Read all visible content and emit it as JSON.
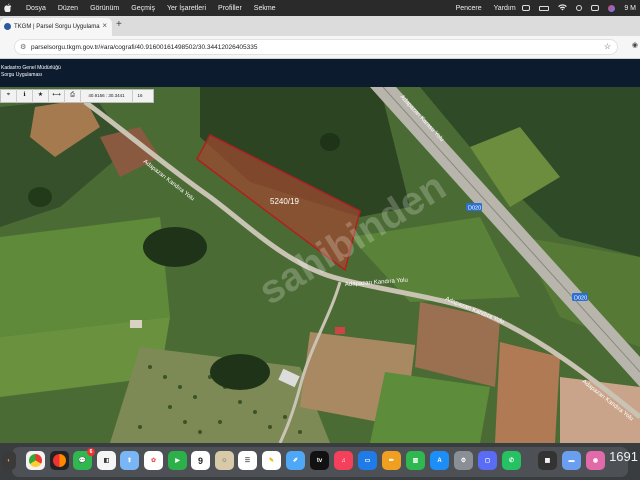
{
  "menubar": {
    "items": [
      "Dosya",
      "Düzen",
      "Görünüm",
      "Geçmiş",
      "Yer İşaretleri",
      "Profiller",
      "Sekme",
      "Pencere",
      "Yardım"
    ],
    "right_time": "9 M"
  },
  "browser": {
    "tab_title": "TKGM | Parsel Sorgu Uygulama",
    "url": "parselsorgu.tkgm.gov.tr/#ara/cografi/40.91600161498502/30.34412026405335"
  },
  "site": {
    "org_line": "Kadastro Genel Müdürlüğü",
    "app_line": "Sorgu Uygulaması"
  },
  "map_toolbar": {
    "coords": "40.9156 : 30.3441",
    "scale": "16"
  },
  "map": {
    "parcel_label": "5240/19",
    "road_labels": [
      "Adapazarı Kandıra Yolu",
      "Adapazarı Kandıra Yolu",
      "Adapazarı Kandıra Yolu",
      "Adapazarı Kandıra Yolu",
      "Adapazarı Karasu Yolu"
    ],
    "highway_badges": [
      "D020",
      "D020"
    ],
    "watermark": "sahibinden",
    "parcel_color": "#b02020"
  },
  "dock": {
    "badges": [
      "6"
    ],
    "calendar_day": "9",
    "clock_text": "1691"
  }
}
